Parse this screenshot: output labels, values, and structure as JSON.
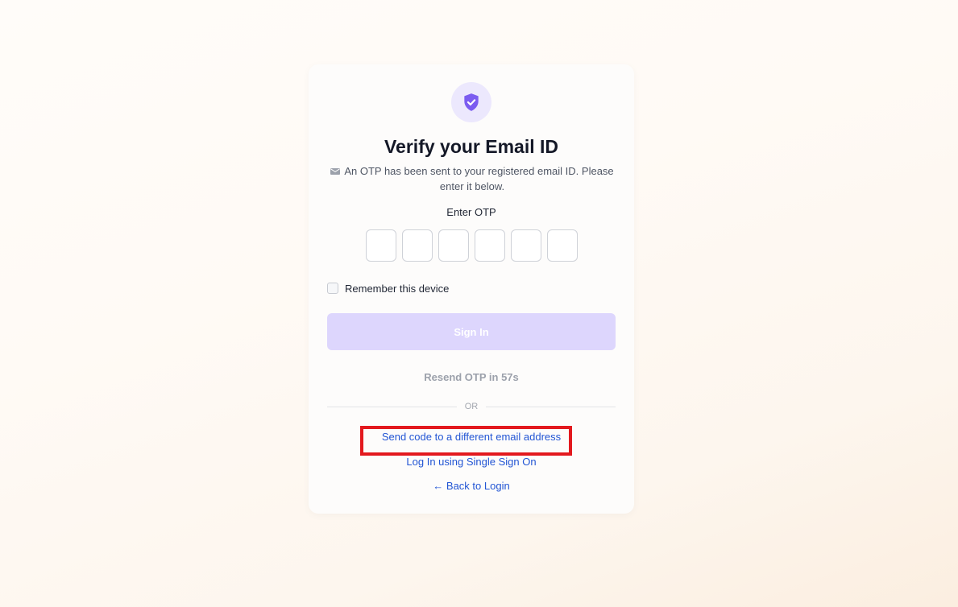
{
  "card": {
    "title": "Verify your Email ID",
    "subtitle": "An OTP has been sent to your registered email ID. Please enter it below.",
    "icons": {
      "header": "shield-check-icon",
      "subtitle": "mail-icon"
    },
    "otp": {
      "label": "Enter OTP",
      "digits": [
        "",
        "",
        "",
        "",
        "",
        ""
      ]
    },
    "remember_label": "Remember this device",
    "remember_checked": false,
    "signin_label": "Sign In",
    "resend_text": "Resend OTP in 57s",
    "divider_text": "OR",
    "links": {
      "different_email": "Send code to a different email address",
      "sso": "Log In using Single Sign On",
      "back": "← Back to Login"
    }
  },
  "colors": {
    "accent": "#7b5cf0",
    "button_disabled": "#ddd6fd",
    "link": "#2255d4",
    "highlight": "#e3191e"
  }
}
